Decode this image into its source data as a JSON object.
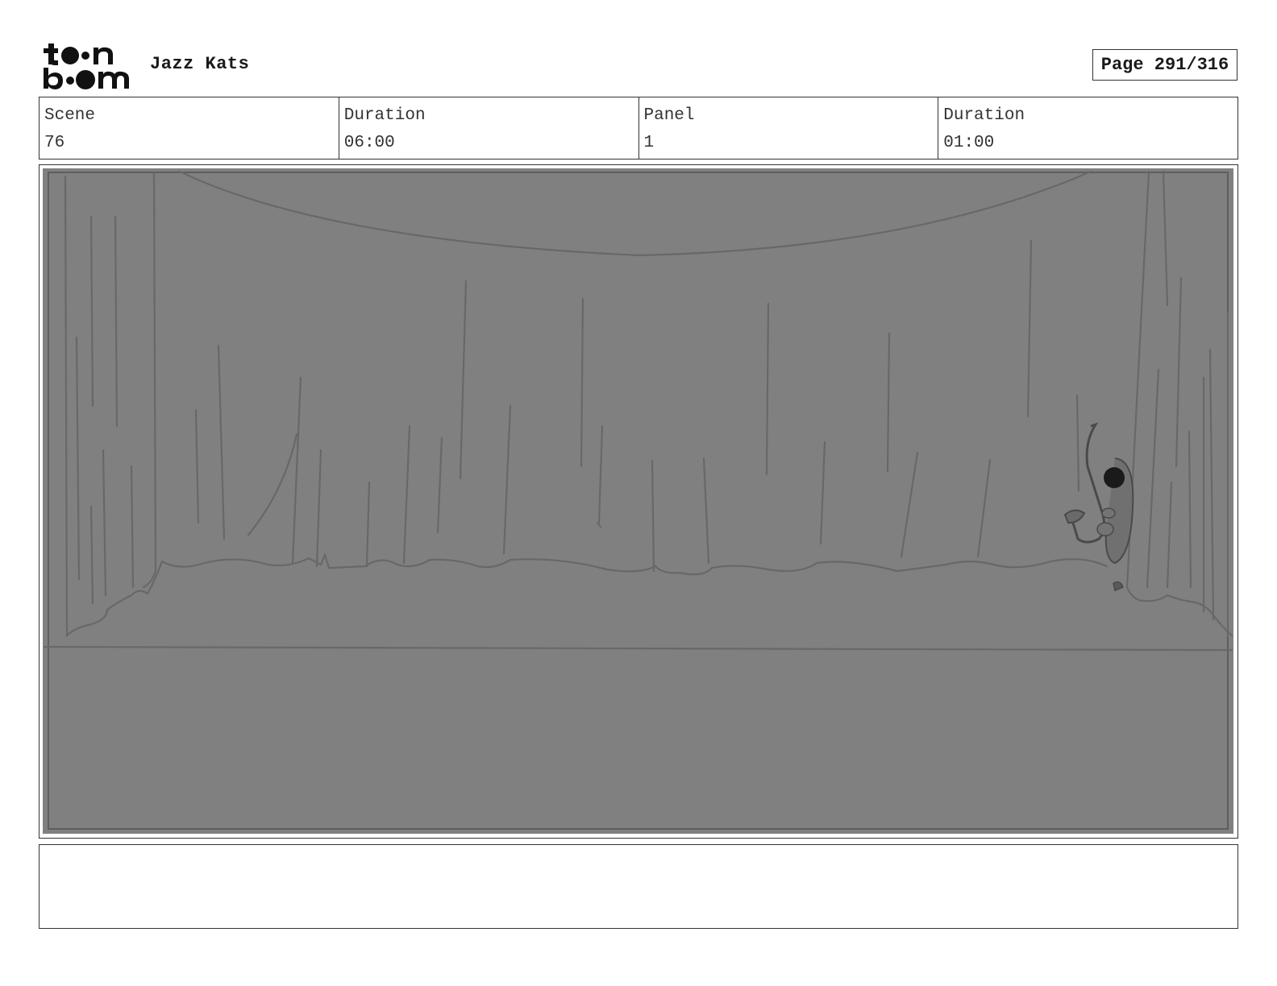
{
  "header": {
    "logo_text": "toon boom",
    "project_title": "Jazz Kats",
    "page_label": "Page 291/316"
  },
  "info": {
    "scene_label": "Scene",
    "scene_value": "76",
    "scene_duration_label": "Duration",
    "scene_duration_value": "06:00",
    "panel_label": "Panel",
    "panel_value": "1",
    "panel_duration_label": "Duration",
    "panel_duration_value": "01:00"
  },
  "notes": {
    "text": ""
  },
  "colors": {
    "panel_fill": "#808080",
    "sketch_line": "#6a6a6a",
    "border": "#333333"
  }
}
